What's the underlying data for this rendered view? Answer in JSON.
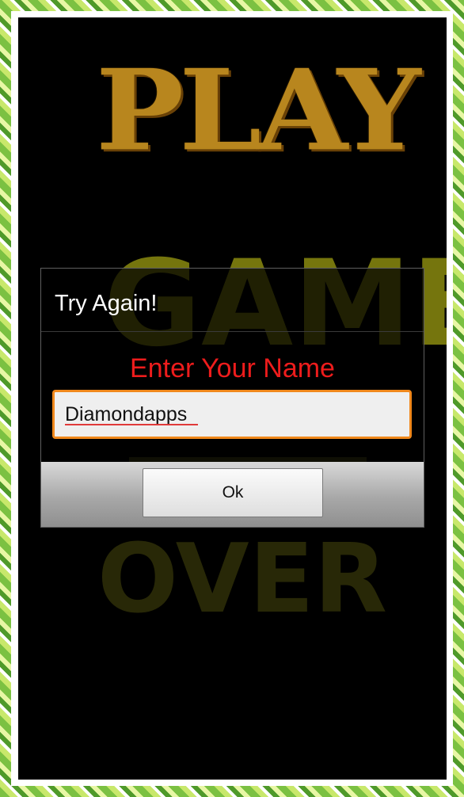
{
  "background": {
    "word_top": "PLAY",
    "word_middle": "GAME",
    "word_bottom": "OVER"
  },
  "dialog": {
    "title": "Try Again!",
    "prompt": "Enter Your Name",
    "name_input": {
      "value": "Diamondapps"
    },
    "ok_label": "Ok"
  },
  "colors": {
    "prompt": "#ee1c1c",
    "input_focus_border": "#f0881c",
    "screen_background": "#000000"
  }
}
